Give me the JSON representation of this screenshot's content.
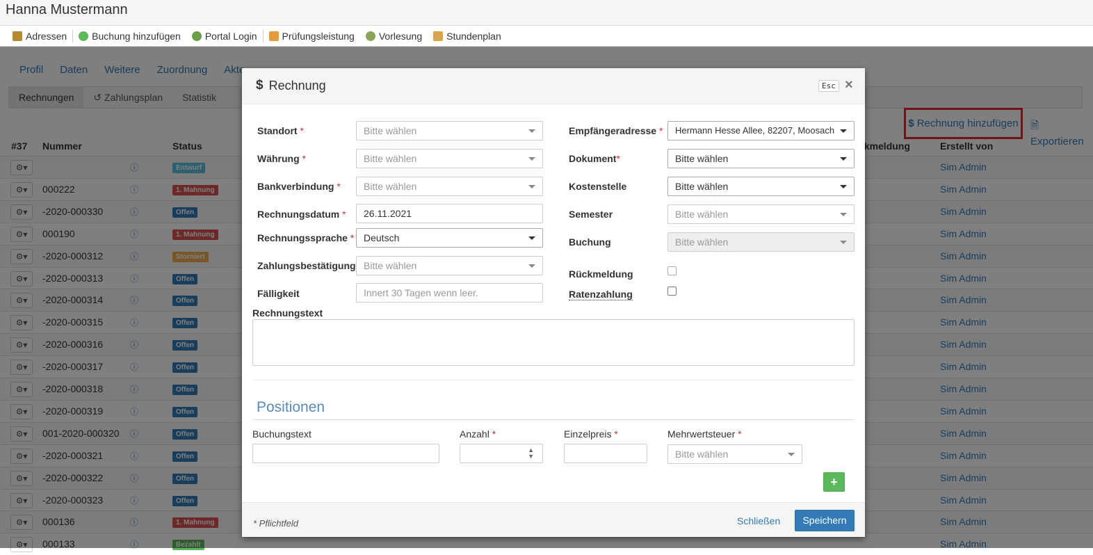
{
  "page": {
    "title": "Hanna Mustermann",
    "quickbar": [
      "Adressen",
      "Buchung hinzufügen",
      "Portal Login",
      "Prüfungsleistung",
      "Vorlesung",
      "Stundenplan"
    ],
    "tabs": [
      "Profil",
      "Daten",
      "Weitere",
      "Zuordnung",
      "Akte"
    ],
    "subtabs": [
      "Rechnungen",
      "Zahlungsplan",
      "Statistik"
    ],
    "add_invoice_label": "Rechnung hinzufügen",
    "export_label": "Exportieren",
    "table_headers": {
      "count": "#37",
      "number": "Nummer",
      "status": "Status",
      "feedback": "ckmeldung",
      "creator": "Erstellt von"
    },
    "rows": [
      {
        "num": "",
        "status": "Entwurf",
        "color": "#5bc0de",
        "creator": "Sim Admin"
      },
      {
        "num": "000222",
        "status": "1. Mahnung",
        "color": "#d9534f",
        "creator": "Sim Admin"
      },
      {
        "num": "-2020-000330",
        "status": "Offen",
        "color": "#337ab7",
        "creator": "Sim Admin"
      },
      {
        "num": "000190",
        "status": "1. Mahnung",
        "color": "#d9534f",
        "creator": "Sim Admin"
      },
      {
        "num": "-2020-000312",
        "status": "Storniert",
        "color": "#f0ad4e",
        "creator": "Sim Admin"
      },
      {
        "num": "-2020-000313",
        "status": "Offen",
        "color": "#337ab7",
        "creator": "Sim Admin"
      },
      {
        "num": "-2020-000314",
        "status": "Offen",
        "color": "#337ab7",
        "creator": "Sim Admin"
      },
      {
        "num": "-2020-000315",
        "status": "Offen",
        "color": "#337ab7",
        "creator": "Sim Admin"
      },
      {
        "num": "-2020-000316",
        "status": "Offen",
        "color": "#337ab7",
        "creator": "Sim Admin"
      },
      {
        "num": "-2020-000317",
        "status": "Offen",
        "color": "#337ab7",
        "creator": "Sim Admin"
      },
      {
        "num": "-2020-000318",
        "status": "Offen",
        "color": "#337ab7",
        "creator": "Sim Admin"
      },
      {
        "num": "-2020-000319",
        "status": "Offen",
        "color": "#337ab7",
        "creator": "Sim Admin"
      },
      {
        "num": "001-2020-000320",
        "status": "Offen",
        "color": "#337ab7",
        "creator": "Sim Admin"
      },
      {
        "num": "-2020-000321",
        "status": "Offen",
        "color": "#337ab7",
        "creator": "Sim Admin"
      },
      {
        "num": "-2020-000322",
        "status": "Offen",
        "color": "#337ab7",
        "creator": "Sim Admin"
      },
      {
        "num": "-2020-000323",
        "status": "Offen",
        "color": "#337ab7",
        "creator": "Sim Admin"
      },
      {
        "num": "000136",
        "status": "1. Mahnung",
        "color": "#d9534f",
        "creator": "Sim Admin"
      },
      {
        "num": "000133",
        "status": "Bezahlt",
        "color": "#5cb85c",
        "creator": "Sim Admin"
      }
    ]
  },
  "modal": {
    "title": "Rechnung",
    "esc": "Esc",
    "close": "×",
    "left_fields": {
      "standort": {
        "label": "Standort",
        "value": "Bitte wählen"
      },
      "waehrung": {
        "label": "Währung",
        "value": "Bitte wählen"
      },
      "bank": {
        "label": "Bankverbindung",
        "value": "Bitte wählen"
      },
      "datum": {
        "label": "Rechnungsdatum",
        "value": "26.11.2021"
      },
      "sprache": {
        "label": "Rechnungssprache",
        "value": "Deutsch"
      },
      "zahlung": {
        "label": "Zahlungsbestätigung",
        "value": "Bitte wählen"
      },
      "faellig": {
        "label": "Fälligkeit",
        "placeholder": "Innert 30 Tagen wenn leer."
      }
    },
    "right_fields": {
      "empfaenger": {
        "label": "Empfängeradresse",
        "value": "Hermann Hesse Allee, 82207, Moosach"
      },
      "dokument": {
        "label": "Dokument",
        "value": "Bitte wählen"
      },
      "kostenstelle": {
        "label": "Kostenstelle",
        "value": "Bitte wählen"
      },
      "semester": {
        "label": "Semester",
        "value": "Bitte wählen"
      },
      "buchung": {
        "label": "Buchung",
        "value": "Bitte wählen"
      },
      "rueckmeldung": {
        "label": "Rückmeldung"
      },
      "raten": {
        "label": "Ratenzahlung"
      }
    },
    "text_label": "Rechnungstext",
    "positions_title": "Positionen",
    "positions": {
      "buchungstext": "Buchungstext",
      "anzahl": "Anzahl",
      "einzelpreis": "Einzelpreis",
      "mwst": "Mehrwertsteuer",
      "mwst_value": "Bitte wählen"
    },
    "required_mark": "*",
    "plus": "+",
    "footer": {
      "note": "* Pflichtfeld",
      "close": "Schließen",
      "save": "Speichern"
    }
  }
}
